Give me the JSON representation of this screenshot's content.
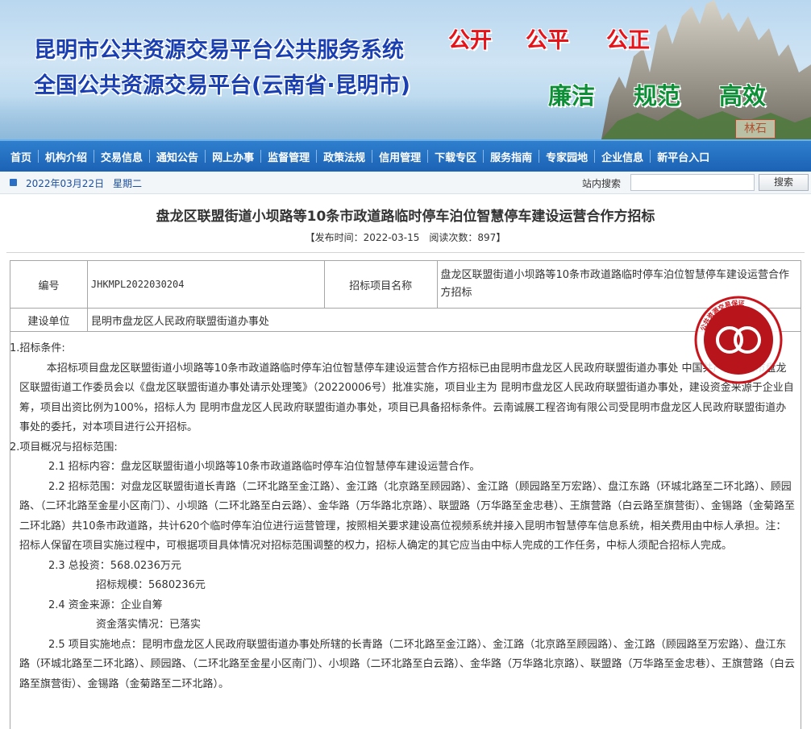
{
  "banner": {
    "title_line1": "昆明市公共资源交易平台公共服务系统",
    "title_line2": "全国公共资源交易平台(云南省·昆明市)",
    "slogan_red": [
      "公开",
      "公平",
      "公正"
    ],
    "slogan_green": [
      "廉洁",
      "规范",
      "高效"
    ],
    "stamp_text": "林石"
  },
  "nav": {
    "items": [
      "首页",
      "机构介绍",
      "交易信息",
      "通知公告",
      "网上办事",
      "监督管理",
      "政策法规",
      "信用管理",
      "下载专区",
      "服务指南",
      "专家园地",
      "企业信息",
      "新平台入口"
    ]
  },
  "datebar": {
    "date": "2022年03月22日",
    "weekday": "星期二",
    "search_label": "站内搜索",
    "search_value": "",
    "search_button": "搜索"
  },
  "article": {
    "title": "盘龙区联盟街道小坝路等10条市政道路临时停车泊位智慧停车建设运营合作方招标",
    "meta": "【发布时间：2022-03-15　阅读次数：897】",
    "info": {
      "code_label": "编号",
      "code_value": "JHKMPL2022030204",
      "project_label": "招标项目名称",
      "project_value": "盘龙区联盟街道小坝路等10条市政道路临时停车泊位智慧停车建设运营合作方招标",
      "unit_label": "建设单位",
      "unit_value": "昆明市盘龙区人民政府联盟街道办事处"
    },
    "sections": {
      "s1_heading": "1.招标条件:",
      "s1_p1": "本招标项目盘龙区联盟街道小坝路等10条市政道路临时停车泊位智慧停车建设运营合作方招标已由昆明市盘龙区人民政府联盟街道办事处 中国共产党昆明市盘龙区联盟街道工作委员会以《盘龙区联盟街道办事处请示处理笺》（20220006号）批准实施，项目业主为 昆明市盘龙区人民政府联盟街道办事处，建设资金来源于企业自筹，项目出资比例为100%，招标人为 昆明市盘龙区人民政府联盟街道办事处，项目已具备招标条件。云南诚展工程咨询有限公司受昆明市盘龙区人民政府联盟街道办事处的委托，对本项目进行公开招标。",
      "s2_heading": "2.项目概况与招标范围:",
      "s2_1": "2.1 招标内容：盘龙区联盟街道小坝路等10条市政道路临时停车泊位智慧停车建设运营合作。",
      "s2_2": "2.2 招标范围：对盘龙区联盟街道长青路（二环北路至金江路）、金江路（北京路至顾园路）、金江路（顾园路至万宏路）、盘江东路（环城北路至二环北路）、顾园路、（二环北路至金星小区南门）、小坝路（二环北路至白云路）、金华路（万华路北京路）、联盟路（万华路至金忠巷）、王旗营路（白云路至旗营街）、金锡路（金菊路至二环北路）共10条市政道路，共计620个临时停车泊位进行运营管理，按照相关要求建设高位视频系统并接入昆明市智慧停车信息系统，相关费用由中标人承担。注：招标人保留在项目实施过程中，可根据项目具体情况对招标范围调整的权力，招标人确定的其它应当由中标人完成的工作任务，中标人须配合招标人完成。",
      "s2_3a": "2.3 总投资：568.0236万元",
      "s2_3b": "招标规模：5680236元",
      "s2_4a": "2.4 资金来源：企业自筹",
      "s2_4b": "资金落实情况：已落实",
      "s2_5": "2.5 项目实施地点：昆明市盘龙区人民政府联盟街道办事处所辖的长青路（二环北路至金江路）、金江路（北京路至顾园路）、金江路（顾园路至万宏路）、盘江东路（环城北路至二环北路）、顾园路、（二环北路至金星小区南门）、小坝路（二环北路至白云路）、金华路（万华路北京路）、联盟路（万华路至金忠巷）、王旗营路（白云路至旗营街）、金锡路（金菊路至二环北路）。"
    }
  },
  "watermark": {
    "text": "公共资源交易保证"
  },
  "colors": {
    "nav_bg": "#1c62b4",
    "title_blue": "#1a3fb0",
    "slogan_red": "#e5141b",
    "slogan_green": "#0c8f36",
    "seal_red": "#c9141c"
  }
}
